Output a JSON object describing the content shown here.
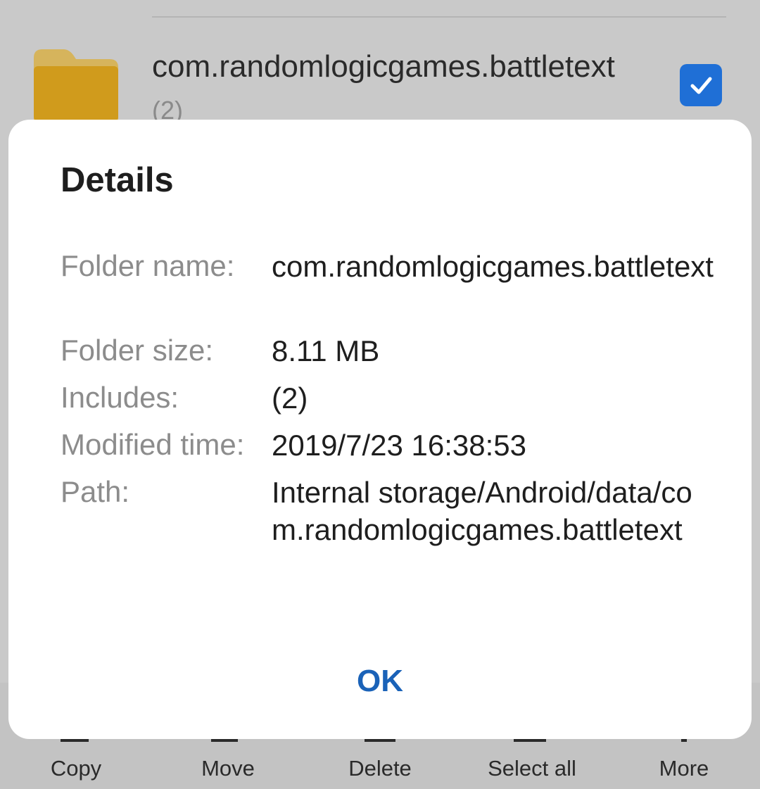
{
  "file_list": {
    "item": {
      "name": "com.randomlogicgames.battletext",
      "count": "(2)",
      "checked": true,
      "icon": "folder-icon"
    }
  },
  "dialog": {
    "title": "Details",
    "rows": [
      {
        "label": "Folder name:",
        "value": "com.randomlogicgames.battletext"
      },
      {
        "label": "Folder size:",
        "value": "8.11 MB"
      },
      {
        "label": "Includes:",
        "value": "(2)"
      },
      {
        "label": "Modified time:",
        "value": "2019/7/23 16:38:53"
      },
      {
        "label": "Path:",
        "value": "Internal storage/Android/data/com.randomlogicgames.battletext"
      }
    ],
    "ok_label": "OK"
  },
  "toolbar": {
    "items": [
      {
        "label": "Copy",
        "icon": "copy-icon"
      },
      {
        "label": "Move",
        "icon": "move-icon"
      },
      {
        "label": "Delete",
        "icon": "delete-icon"
      },
      {
        "label": "Select all",
        "icon": "select-all-icon"
      },
      {
        "label": "More",
        "icon": "more-icon"
      }
    ]
  },
  "colors": {
    "accent": "#1a62b8",
    "checkbox": "#1f6fd6",
    "folder": "#d09b1c",
    "scrim": "#c9c9c9"
  }
}
